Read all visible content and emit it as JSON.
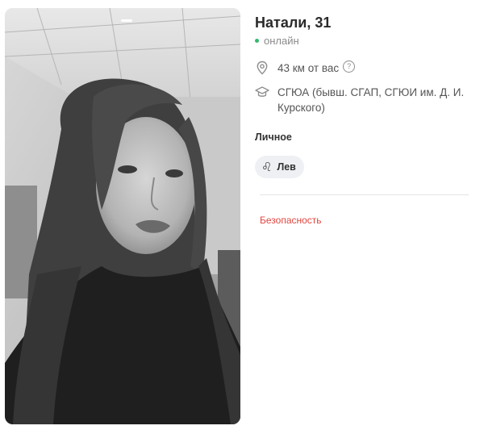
{
  "profile": {
    "name_age": "Натали, 31",
    "status": "онлайн",
    "distance": "43 км от вас",
    "education": "СГЮА (бывш. СГАП, СГЮИ им. Д. И. Курского)"
  },
  "personal": {
    "title": "Личное",
    "zodiac_label": "Лев",
    "zodiac_glyph": "♌"
  },
  "links": {
    "safety": "Безопасность"
  },
  "icons": {
    "help": "?",
    "location": "location-pin-icon",
    "education": "graduation-cap-icon"
  },
  "colors": {
    "online": "#34b86d",
    "safety": "#e0463f"
  }
}
